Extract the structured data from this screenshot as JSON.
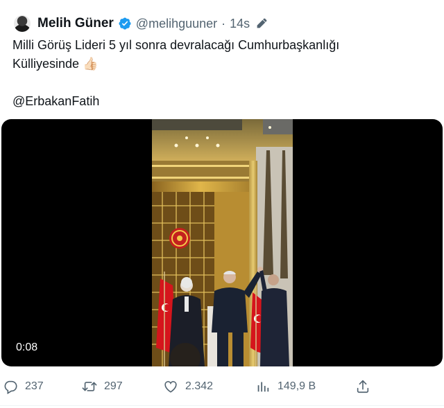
{
  "tweet": {
    "author_name": "Melih Güner",
    "handle": "@melihguuner",
    "separator": "·",
    "time": "14s",
    "text_line1": "Milli Görüş Lideri 5 yıl sonra devralacağı Cumhurbaşkanlığı",
    "text_line2": "Külliyesinde",
    "emoji": "👍🏻",
    "mention": "@ErbakanFatih"
  },
  "media": {
    "duration": "0:08"
  },
  "actions": {
    "replies": "237",
    "retweets": "297",
    "likes": "2.342",
    "views": "149,9 B"
  },
  "icons": {
    "verified": "verified-badge-icon",
    "edit": "edit-pencil-icon",
    "reply": "reply-icon",
    "retweet": "retweet-icon",
    "like": "heart-icon",
    "views": "views-chart-icon",
    "share": "share-icon"
  },
  "colors": {
    "verified_blue": "#1d9bf0",
    "secondary_text": "#536471",
    "primary_text": "#0f1419"
  }
}
